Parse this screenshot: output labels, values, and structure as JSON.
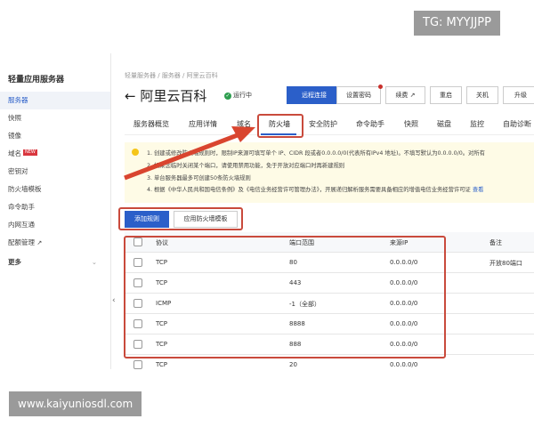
{
  "watermark_top": "TG: MYYJJPP",
  "watermark_bottom": "www.kaiyuniosdl.com",
  "sidebar": {
    "title": "轻量应用服务器",
    "items": [
      {
        "label": "服务器"
      },
      {
        "label": "快照"
      },
      {
        "label": "镜像"
      },
      {
        "label": "域名",
        "badge": "NEW"
      },
      {
        "label": "密钥对"
      },
      {
        "label": "防火墙模板"
      },
      {
        "label": "命令助手"
      },
      {
        "label": "内网互通"
      },
      {
        "label": "配额管理"
      },
      {
        "label": "更多"
      }
    ]
  },
  "breadcrumb": [
    "轻量服务器",
    "服务器",
    "阿里云百科"
  ],
  "header": {
    "title": "阿里云百科",
    "status": "运行中",
    "buttons": [
      "远程连接",
      "设置密码",
      "续费",
      "重启",
      "关机",
      "升级"
    ]
  },
  "tabs": [
    "服务器概览",
    "应用详情",
    "域名",
    "防火墙",
    "安全防护",
    "命令助手",
    "快照",
    "磁盘",
    "监控",
    "自助诊断"
  ],
  "notice": [
    "1. 创建或修改防火墙规则时，限制IP来源可填写单个 IP、CIDR 段或者0.0.0.0/0(代表所有IPv4 地址)。不填写默认为0.0.0.0/0。对所有",
    "2. 如果您临时关闭某个端口，请使用禁用功能，免于开放对应端口时再新建规则",
    "3. 单台服务器最多可创建50条防火墙规则",
    "4. 根据《中华人民共和国电信条例》及《电信业务经营许可管理办法》，开展递归解析服务需要具备相应的增值电信业务经营许可证"
  ],
  "notice_link": "查看",
  "actions": {
    "add": "添加规则",
    "template": "应用防火墙模板"
  },
  "table": {
    "headers": [
      "协议",
      "端口范围",
      "来源IP",
      "备注"
    ],
    "rows": [
      [
        "TCP",
        "80",
        "0.0.0.0/0",
        "开放80端口"
      ],
      [
        "TCP",
        "443",
        "0.0.0.0/0",
        ""
      ],
      [
        "ICMP",
        "-1（全部）",
        "0.0.0.0/0",
        ""
      ],
      [
        "TCP",
        "8888",
        "0.0.0.0/0",
        ""
      ],
      [
        "TCP",
        "888",
        "0.0.0.0/0",
        ""
      ],
      [
        "TCP",
        "20",
        "0.0.0.0/0",
        ""
      ]
    ]
  },
  "colors": {
    "primary": "#2b5fc9",
    "highlight": "#c94a3c",
    "notice_bg": "#fefbe6"
  }
}
